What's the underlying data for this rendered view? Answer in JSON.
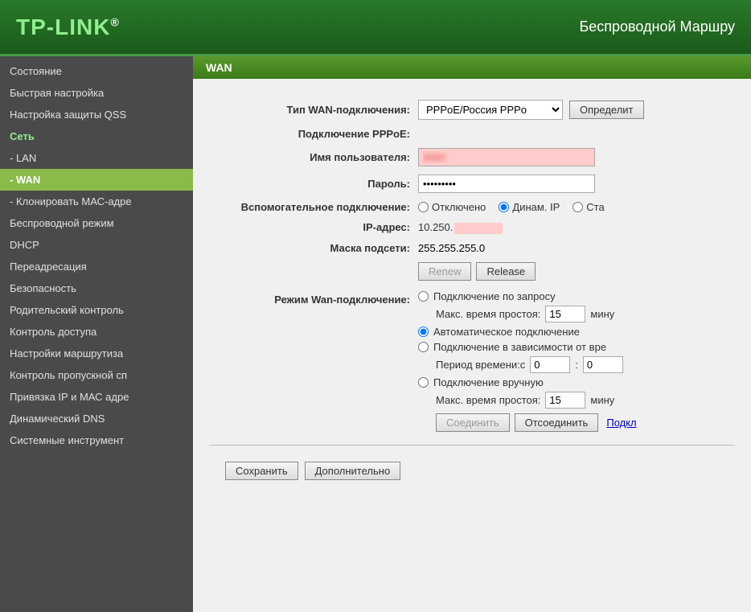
{
  "header": {
    "logo": "TP-LINK",
    "logo_dot": "®",
    "title": "Беспроводной Маршру"
  },
  "sidebar": {
    "items": [
      {
        "id": "status",
        "label": "Состояние",
        "active": false,
        "indent": false
      },
      {
        "id": "quick-setup",
        "label": "Быстрая настройка",
        "active": false,
        "indent": false
      },
      {
        "id": "qss",
        "label": "Настройка защиты QSS",
        "active": false,
        "indent": false
      },
      {
        "id": "network",
        "label": "Сеть",
        "active": false,
        "indent": false,
        "section": true
      },
      {
        "id": "lan",
        "label": "- LAN",
        "active": false,
        "indent": true
      },
      {
        "id": "wan",
        "label": "- WAN",
        "active": true,
        "indent": true
      },
      {
        "id": "mac-clone",
        "label": "- Клонировать МАС-адре",
        "active": false,
        "indent": true
      },
      {
        "id": "wireless",
        "label": "Беспроводной режим",
        "active": false,
        "indent": false
      },
      {
        "id": "dhcp",
        "label": "DHCP",
        "active": false,
        "indent": false
      },
      {
        "id": "forwarding",
        "label": "Переадресация",
        "active": false,
        "indent": false
      },
      {
        "id": "security",
        "label": "Безопасность",
        "active": false,
        "indent": false
      },
      {
        "id": "parental",
        "label": "Родительский контроль",
        "active": false,
        "indent": false
      },
      {
        "id": "access",
        "label": "Контроль доступа",
        "active": false,
        "indent": false
      },
      {
        "id": "routing",
        "label": "Настройки маршрутиза",
        "active": false,
        "indent": false
      },
      {
        "id": "bandwidth",
        "label": "Контроль пропускной сп",
        "active": false,
        "indent": false
      },
      {
        "id": "ip-mac",
        "label": "Привязка IP и МАС адре",
        "active": false,
        "indent": false
      },
      {
        "id": "ddns",
        "label": "Динамический DNS",
        "active": false,
        "indent": false
      },
      {
        "id": "tools",
        "label": "Системные инструмент",
        "active": false,
        "indent": false
      }
    ]
  },
  "content": {
    "section_title": "WAN",
    "wan_type_label": "Тип WAN-подключения:",
    "wan_type_value": "PPPoE/Россия PPPo",
    "detect_button": "Определит",
    "pppoe_label": "Подключение PPPoE:",
    "username_label": "Имя пользователя:",
    "password_label": "Пароль:",
    "password_value": "•••••••••",
    "secondary_label": "Вспомогательное подключение:",
    "radio_disabled": "Отключено",
    "radio_dynamic_ip": "Динам. IP",
    "radio_static": "Ста",
    "ip_label": "IP-адрес:",
    "ip_prefix": "10.250.",
    "mask_label": "Маска подсети:",
    "mask_value": "255.255.255.0",
    "renew_button": "Renew",
    "release_button": "Release",
    "wan_mode_label": "Режим Wan-подключение:",
    "mode_on_demand": "Подключение по запросу",
    "max_idle_label_1": "Макс. время простоя:",
    "max_idle_value_1": "15",
    "minutes_label_1": "мину",
    "mode_auto": "Автоматическое подключение",
    "mode_time_based": "Подключение в зависимости от вре",
    "time_from_label": "Период времени:с",
    "time_from_value": "0",
    "time_to_value": "0",
    "mode_manual": "Подключение вручную",
    "max_idle_label_2": "Макс. время простоя:",
    "max_idle_value_2": "15",
    "minutes_label_2": "мину",
    "connect_button": "Соединить",
    "disconnect_button": "Отсоединить",
    "reconnect_link": "Подкл",
    "save_button": "Сохранить",
    "advanced_button": "Дополнительно"
  }
}
